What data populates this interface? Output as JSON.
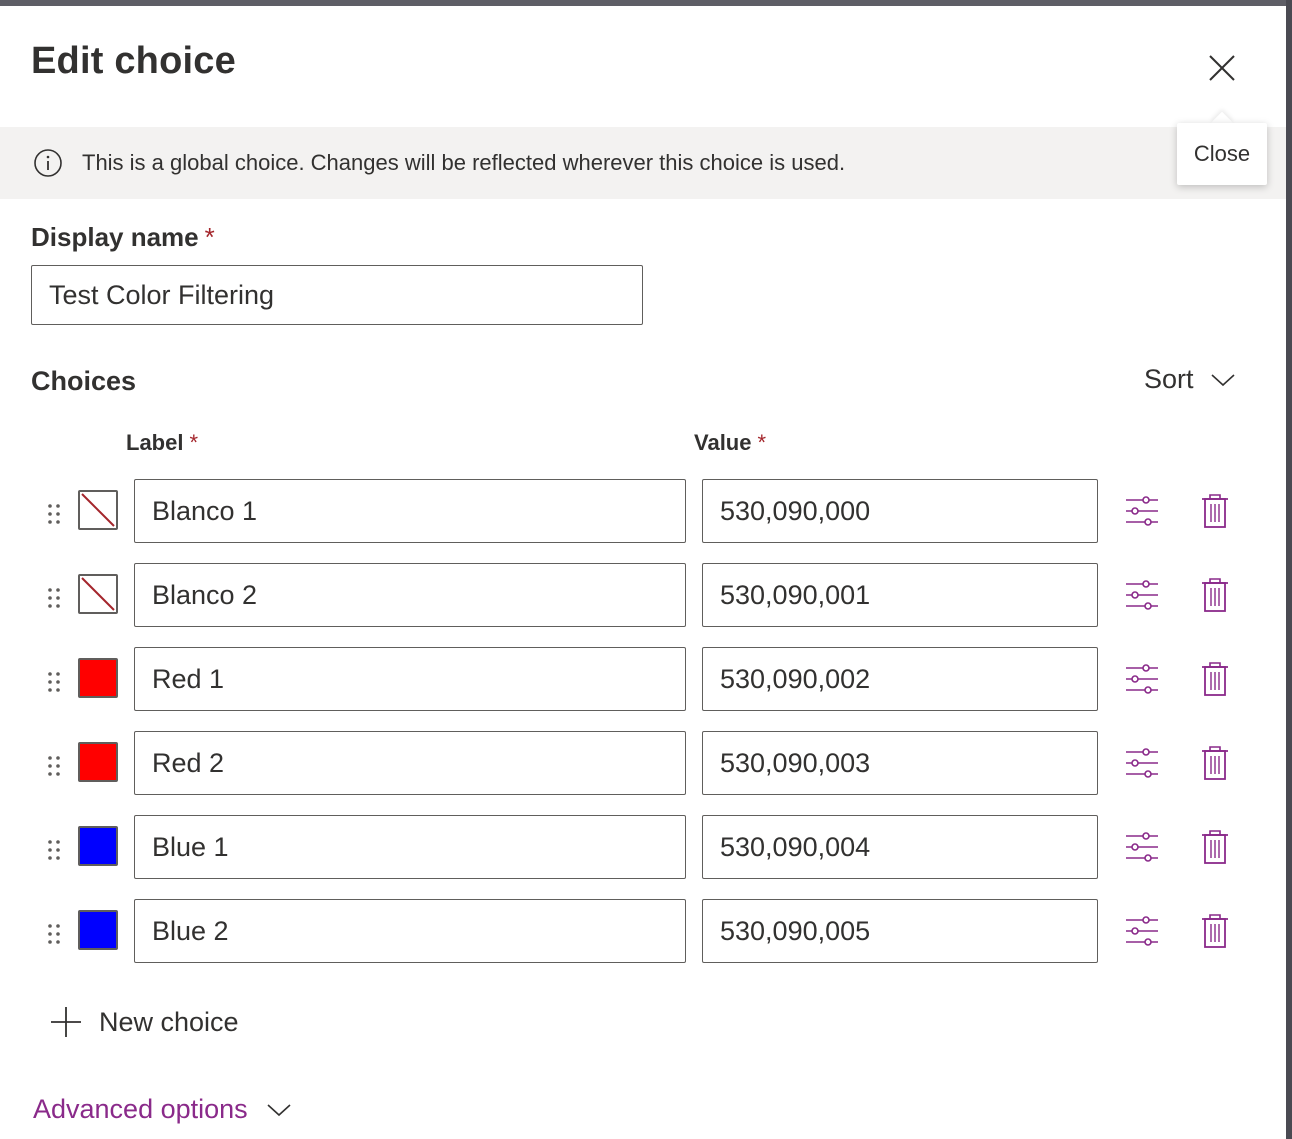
{
  "panel": {
    "title": "Edit choice",
    "close_tooltip": "Close"
  },
  "banner": {
    "text": "This is a global choice. Changes will be reflected wherever this choice is used."
  },
  "display_name": {
    "label": "Display name",
    "required_mark": "*",
    "value": "Test Color Filtering"
  },
  "choices": {
    "title": "Choices",
    "sort_label": "Sort",
    "label_header": "Label",
    "value_header": "Value",
    "required_mark": "*",
    "items": [
      {
        "label": "Blanco 1",
        "value": "530,090,000",
        "color": "none"
      },
      {
        "label": "Blanco 2",
        "value": "530,090,001",
        "color": "none"
      },
      {
        "label": "Red 1",
        "value": "530,090,002",
        "color": "#ff0000"
      },
      {
        "label": "Red 2",
        "value": "530,090,003",
        "color": "#ff0000"
      },
      {
        "label": "Blue 1",
        "value": "530,090,004",
        "color": "#0000ff"
      },
      {
        "label": "Blue 2",
        "value": "530,090,005",
        "color": "#0000ff"
      }
    ],
    "new_choice_label": "New choice"
  },
  "advanced": {
    "label": "Advanced options"
  },
  "colors": {
    "accent": "#8a2a8a",
    "required": "#a4262c",
    "banner_bg": "#f3f2f1",
    "text": "#323130"
  }
}
